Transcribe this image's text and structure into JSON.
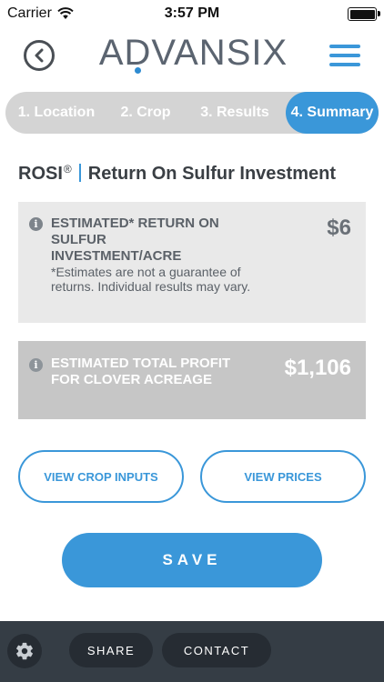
{
  "status_bar": {
    "carrier": "Carrier",
    "time": "3:57 PM",
    "battery_level": 1.0
  },
  "header": {
    "logo_text": "ADVANSIX",
    "back_icon": "chevron-left-circle-icon",
    "menu_icon": "hamburger-menu-icon"
  },
  "steps": [
    {
      "label": "1. Location",
      "active": false
    },
    {
      "label": "2. Crop",
      "active": false
    },
    {
      "label": "3. Results",
      "active": false
    },
    {
      "label": "4. Summary",
      "active": true
    }
  ],
  "section": {
    "title_prefix": "ROSI",
    "registered_mark": "®",
    "title": "Return On Sulfur Investment"
  },
  "cards": {
    "return_per_acre": {
      "heading": "ESTIMATED* RETURN ON SULFUR INVESTMENT/ACRE",
      "note": "*Estimates are not a guarantee of returns. Individual results may vary.",
      "value": "$6"
    },
    "total_profit": {
      "heading": "ESTIMATED TOTAL PROFIT FOR CLOVER ACREAGE",
      "value": "$1,106"
    }
  },
  "actions": {
    "view_crop_inputs": "VIEW CROP INPUTS",
    "view_prices": "VIEW PRICES",
    "save": "SAVE"
  },
  "bottom_bar": {
    "share": "SHARE",
    "contact": "CONTACT",
    "settings_icon": "gear-icon"
  },
  "colors": {
    "accent": "#3a97d9",
    "bottom_bar": "#353d45",
    "card_light": "#e9e9e9",
    "card_dark": "#c6c6c6"
  }
}
